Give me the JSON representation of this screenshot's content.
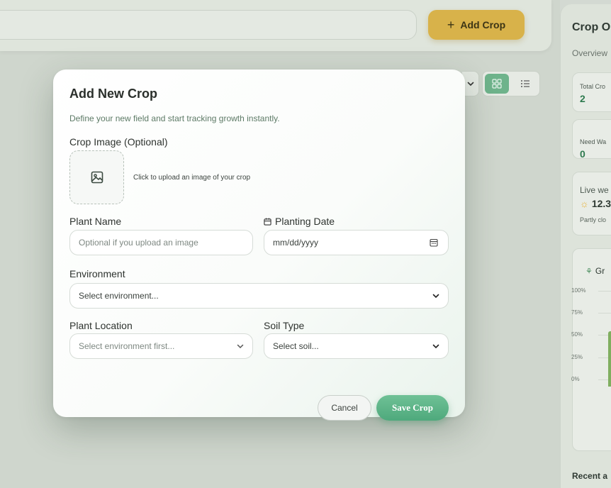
{
  "header": {
    "add_crop_label": "Add Crop"
  },
  "right_panel": {
    "title": "Crop O",
    "subtitle": "Overview",
    "stats": [
      {
        "label": "Total Cro",
        "value": "2"
      },
      {
        "label": "Need Wa",
        "value": "0"
      }
    ],
    "weather": {
      "label": "Live we",
      "temp": "12.3",
      "desc": "Partly clo"
    },
    "growth": {
      "title": "Gr",
      "ticks": [
        "100%",
        "75%",
        "50%",
        "25%",
        "0%"
      ]
    },
    "recent_label": "Recent a"
  },
  "modal": {
    "title": "Add New Crop",
    "subtitle": "Define your new field and start tracking growth instantly.",
    "image_label": "Crop Image (Optional)",
    "upload_hint": "Click to upload an image of your crop",
    "plant_name_label": "Plant Name",
    "plant_name_placeholder": "Optional if you upload an image",
    "planting_date_label": "Planting Date",
    "planting_date_placeholder": "mm/dd/yyyy",
    "environment_label": "Environment",
    "environment_value": "Select environment...",
    "location_label": "Plant Location",
    "location_value": "Select environment first...",
    "soil_label": "Soil Type",
    "soil_value": "Select soil...",
    "cancel_label": "Cancel",
    "save_label": "Save Crop"
  },
  "colors": {
    "accent_green": "#4ea97c",
    "add_button": "#d8b24a"
  }
}
